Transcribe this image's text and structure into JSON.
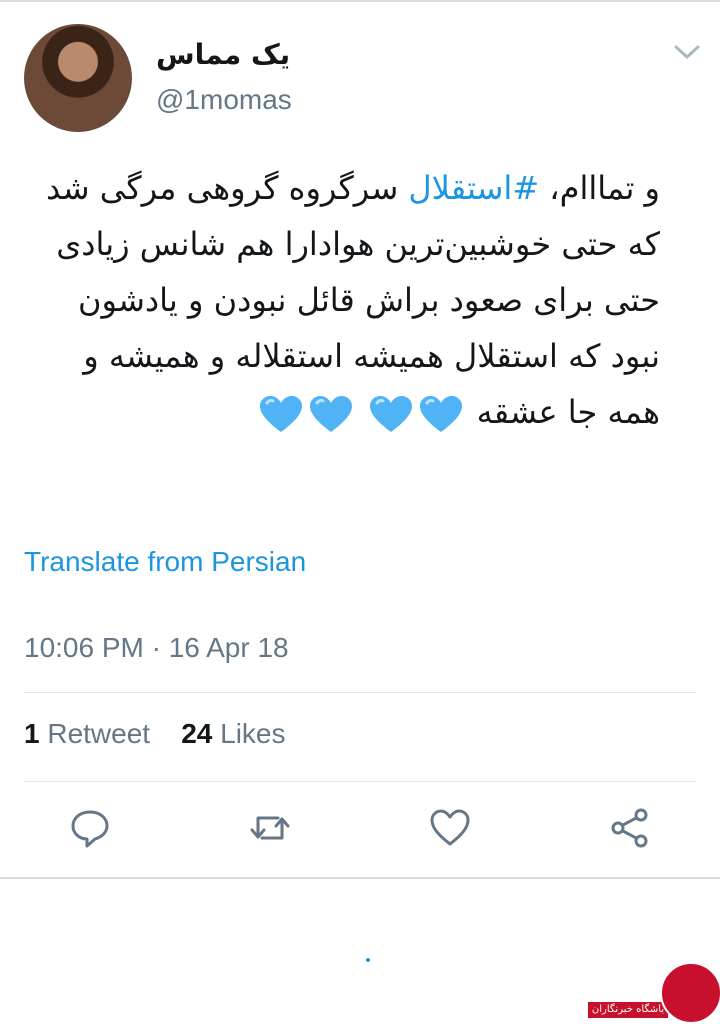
{
  "user": {
    "display_name": "یک مماس",
    "handle": "@1momas"
  },
  "tweet": {
    "text_prefix": "و تمااام، ",
    "hashtag": "#استقلال",
    "text_suffix": " سرگروه گروهی مرگی شد که حتی خوشبین‌ترین هوادارا هم شانس زیادی حتی برای صعود براش قائل نبودن و یادشون نبود که استقلال همیشه استقلاله و همیشه و همه جا عشقه",
    "emoji": [
      "blue-heart",
      "blue-heart",
      "blue-heart",
      "blue-heart"
    ]
  },
  "translate_label": "Translate from Persian",
  "timestamp": "10:06 PM · 16 Apr 18",
  "stats": {
    "retweet_count": "1",
    "retweet_label": "Retweet",
    "likes_count": "24",
    "likes_label": "Likes"
  },
  "actions": [
    "reply-icon",
    "retweet-icon",
    "like-icon",
    "share-icon"
  ],
  "watermark": {
    "label": "باشگاه خبرنگاران"
  },
  "colors": {
    "accent": "#1b95e0",
    "text": "#14171a",
    "muted": "#657786",
    "heart": "#4fb3f5"
  }
}
